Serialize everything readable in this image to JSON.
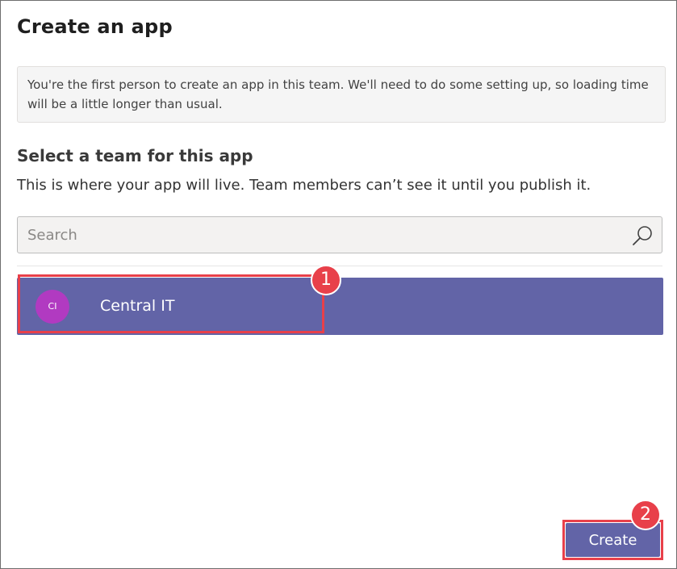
{
  "dialog": {
    "title": "Create an app",
    "notice": "You're the first person to create an app in this team. We'll need to do some setting up, so loading time will be a little longer than usual."
  },
  "team_section": {
    "heading": "Select a team for this app",
    "description": "This is where your app will live. Team members can’t see it until you publish it.",
    "search": {
      "placeholder": "Search",
      "value": ""
    },
    "teams": [
      {
        "initials": "CI",
        "name": "Central IT",
        "selected": true
      }
    ]
  },
  "actions": {
    "create_label": "Create"
  },
  "annotations": [
    {
      "number": "1",
      "target": "team-item-central-it"
    },
    {
      "number": "2",
      "target": "create-button"
    }
  ],
  "colors": {
    "accent": "#6264a7",
    "avatar": "#b13ac1",
    "annotation": "#e8404a",
    "notice_background": "#f5f5f5"
  },
  "icons": {
    "search": "search-icon"
  }
}
